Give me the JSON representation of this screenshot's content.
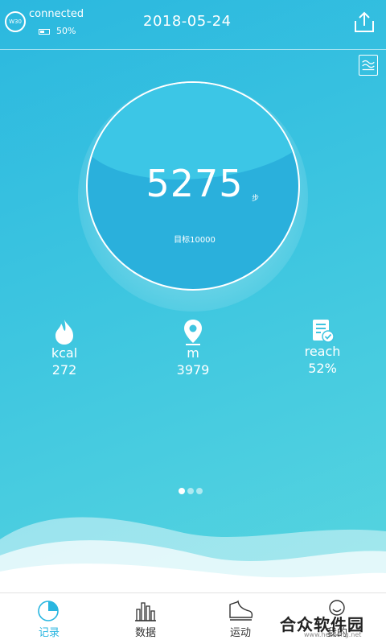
{
  "status": {
    "connection": "connected",
    "device_label": "W30",
    "battery": "50%",
    "date": "2018-05-24"
  },
  "ring": {
    "steps": "5275",
    "steps_unit": "步",
    "goal": "目标10000"
  },
  "stats": [
    {
      "label": "kcal",
      "value": "272",
      "icon": "flame-icon"
    },
    {
      "label": "m",
      "value": "3979",
      "icon": "location-pin-icon"
    },
    {
      "label": "reach",
      "value": "52%",
      "icon": "checklist-icon"
    }
  ],
  "pager": {
    "count": 3,
    "active": 0
  },
  "nav": [
    {
      "label": "记录",
      "icon": "pie-chart-icon",
      "active": true
    },
    {
      "label": "数据",
      "icon": "bar-chart-icon",
      "active": false
    },
    {
      "label": "运动",
      "icon": "shoe-icon",
      "active": false
    },
    {
      "label": "我的",
      "icon": "profile-icon",
      "active": false
    }
  ],
  "watermark": {
    "text": "合众软件园",
    "url": "www.hezhong.net"
  },
  "colors": {
    "primary": "#2bb8df",
    "active_nav": "#29b6e0"
  }
}
